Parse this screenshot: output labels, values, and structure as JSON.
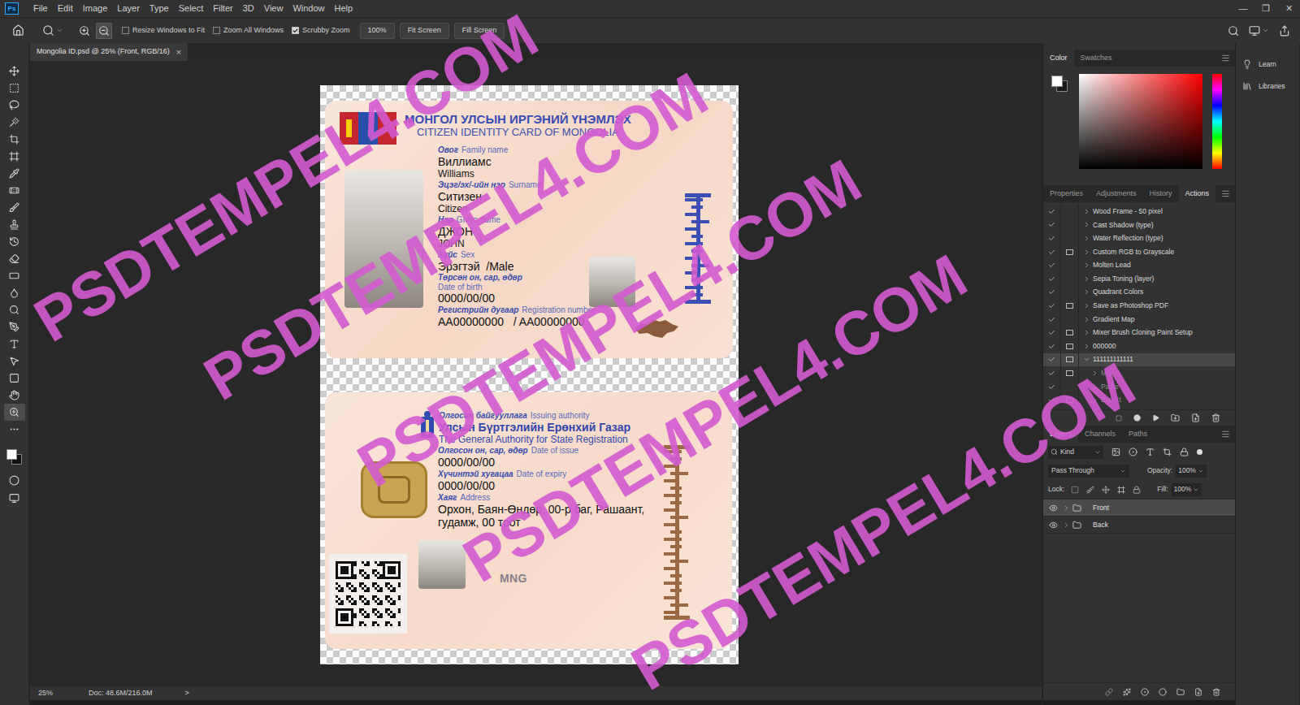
{
  "app": {
    "logo": "Ps",
    "menu": [
      "File",
      "Edit",
      "Image",
      "Layer",
      "Type",
      "Select",
      "Filter",
      "3D",
      "View",
      "Window",
      "Help"
    ],
    "window_controls": [
      "—",
      "❐",
      "✕"
    ]
  },
  "options_bar": {
    "zoom_in_active": false,
    "zoom_out_active": true,
    "checkboxes": [
      {
        "label": "Resize Windows to Fit",
        "checked": false
      },
      {
        "label": "Zoom All Windows",
        "checked": false
      },
      {
        "label": "Scrubby Zoom",
        "checked": true
      }
    ],
    "buttons": [
      "100%",
      "Fit Screen",
      "Fill Screen"
    ]
  },
  "toolbar": {
    "active_tool": "zoom",
    "foreground": "#ffffff",
    "background": "#111111"
  },
  "document": {
    "tab": "Mongolia ID.psd @ 25% (Front, RGB/16)",
    "close": "×",
    "watermarks": [
      "PSDTEMPEL4.COM",
      "PSDTEMPEL4.COM",
      "PSDTEMPEL4.COM",
      "PSDTEMPEL4.COM",
      "PSDTEMPEL4.COM"
    ],
    "front": {
      "title_mn": "МОНГОЛ УЛСЫН ИРГЭНИЙ ҮНЭМЛЭХ",
      "title_en": "CITIZEN IDENTITY CARD OF MONGOLIA",
      "fields": [
        {
          "kind": "inline",
          "label_mn": "Овог",
          "label_en": "Family name",
          "values": [
            "Виллиамс",
            "Williams"
          ]
        },
        {
          "kind": "inline",
          "label_mn": "Эцэг/эх/-ийн нэр",
          "label_en": "Surname",
          "values": [
            "Ситизен",
            "Citizen"
          ]
        },
        {
          "kind": "inline",
          "label_mn": "Нэр",
          "label_en": "Given name",
          "values": [
            "ДЖОН",
            "JOHN"
          ]
        },
        {
          "kind": "inline",
          "label_mn": "Хүйс",
          "label_en": "Sex",
          "values": [
            "Эрэгтэй  /Male"
          ]
        },
        {
          "kind": "stacked",
          "label_mn": "Төрсөн он, сар, өдөр",
          "label_en": "Date of birth",
          "values": [
            "0000/00/00"
          ]
        },
        {
          "kind": "inline",
          "label_mn": "Регистрийн дугаар",
          "label_en": "Registration number",
          "values": [
            "AA00000000   / AA00000000"
          ]
        }
      ]
    },
    "back": {
      "authority_label_mn": "Олгосон байгууллага",
      "authority_label_en": "Issuing authority",
      "authority_mn": "Улсын Бүртгэлийн Ерөнхий Газар",
      "authority_en": "The General Authority for State Registration",
      "fields": [
        {
          "label_mn": "Олгосон он, сар, өдөр",
          "label_en": "Date of issue",
          "value": "0000/00/00"
        },
        {
          "label_mn": "Хүчинтэй хугацаа",
          "label_en": "Date of expiry",
          "value": "0000/00/00"
        },
        {
          "label_mn": "Хаяг",
          "label_en": "Address",
          "value": "Орхон, Баян-Өндөр, 00-р баг, Рашаант, гудамж, 00 тоот"
        }
      ],
      "code": "MNG"
    }
  },
  "status_bar": {
    "zoom": "25%",
    "doc": "Doc: 48.6M/216.0M",
    "arrow": ">"
  },
  "color_panel": {
    "tabs": [
      {
        "label": "Color",
        "selected": true
      },
      {
        "label": "Swatches",
        "selected": false
      }
    ],
    "foreground": "#ffffff",
    "background": "#1a1a1a",
    "hue": "#ff0000"
  },
  "actions_panel": {
    "tabs": [
      {
        "label": "Properties",
        "selected": false
      },
      {
        "label": "Adjustments",
        "selected": false
      },
      {
        "label": "History",
        "selected": false
      },
      {
        "label": "Actions",
        "selected": true
      }
    ],
    "items": [
      {
        "label": "Wood Frame - 50 pixel",
        "kind": "action",
        "checked": true,
        "dialog": false,
        "expanded": false,
        "selected": false
      },
      {
        "label": "Cast Shadow (type)",
        "kind": "action",
        "checked": true,
        "dialog": false,
        "expanded": false,
        "selected": false
      },
      {
        "label": "Water Reflection (type)",
        "kind": "action",
        "checked": true,
        "dialog": false,
        "expanded": false,
        "selected": false
      },
      {
        "label": "Custom RGB to Grayscale",
        "kind": "action",
        "checked": true,
        "dialog": true,
        "expanded": false,
        "selected": false
      },
      {
        "label": "Molten Lead",
        "kind": "action",
        "checked": true,
        "dialog": false,
        "expanded": false,
        "selected": false
      },
      {
        "label": "Sepia Toning (layer)",
        "kind": "action",
        "checked": true,
        "dialog": false,
        "expanded": false,
        "selected": false
      },
      {
        "label": "Quadrant Colors",
        "kind": "action",
        "checked": true,
        "dialog": false,
        "expanded": false,
        "selected": false
      },
      {
        "label": "Save as Photoshop PDF",
        "kind": "action",
        "checked": true,
        "dialog": true,
        "expanded": false,
        "selected": false
      },
      {
        "label": "Gradient Map",
        "kind": "action",
        "checked": true,
        "dialog": false,
        "expanded": false,
        "selected": false
      },
      {
        "label": "Mixer Brush Cloning Paint Setup",
        "kind": "action",
        "checked": true,
        "dialog": true,
        "expanded": false,
        "selected": false
      },
      {
        "label": "000000",
        "kind": "action",
        "checked": true,
        "dialog": true,
        "expanded": false,
        "selected": false
      },
      {
        "label": "111111111111",
        "kind": "action",
        "checked": true,
        "dialog": true,
        "expanded": true,
        "selected": true
      },
      {
        "label": "Make",
        "kind": "step",
        "checked": true,
        "dialog": true,
        "expanded": false,
        "selected": false
      },
      {
        "label": "Paste",
        "kind": "step",
        "checked": true,
        "dialog": false,
        "expanded": false,
        "selected": false
      },
      {
        "label": "Export",
        "kind": "step",
        "checked": true,
        "dialog": true,
        "expanded": false,
        "selected": false
      }
    ]
  },
  "layers_panel": {
    "tabs": [
      {
        "label": "Layers",
        "selected": true
      },
      {
        "label": "Channels",
        "selected": false
      },
      {
        "label": "Paths",
        "selected": false
      }
    ],
    "filter": "Kind",
    "blend_mode": "Pass Through",
    "opacity_label": "Opacity:",
    "opacity": "100%",
    "lock_label": "Lock:",
    "fill_label": "Fill:",
    "fill": "100%",
    "layers": [
      {
        "name": "Front",
        "visible": true,
        "selected": true
      },
      {
        "name": "Back",
        "visible": true,
        "selected": false
      }
    ]
  },
  "side": [
    "Learn",
    "Libraries"
  ]
}
